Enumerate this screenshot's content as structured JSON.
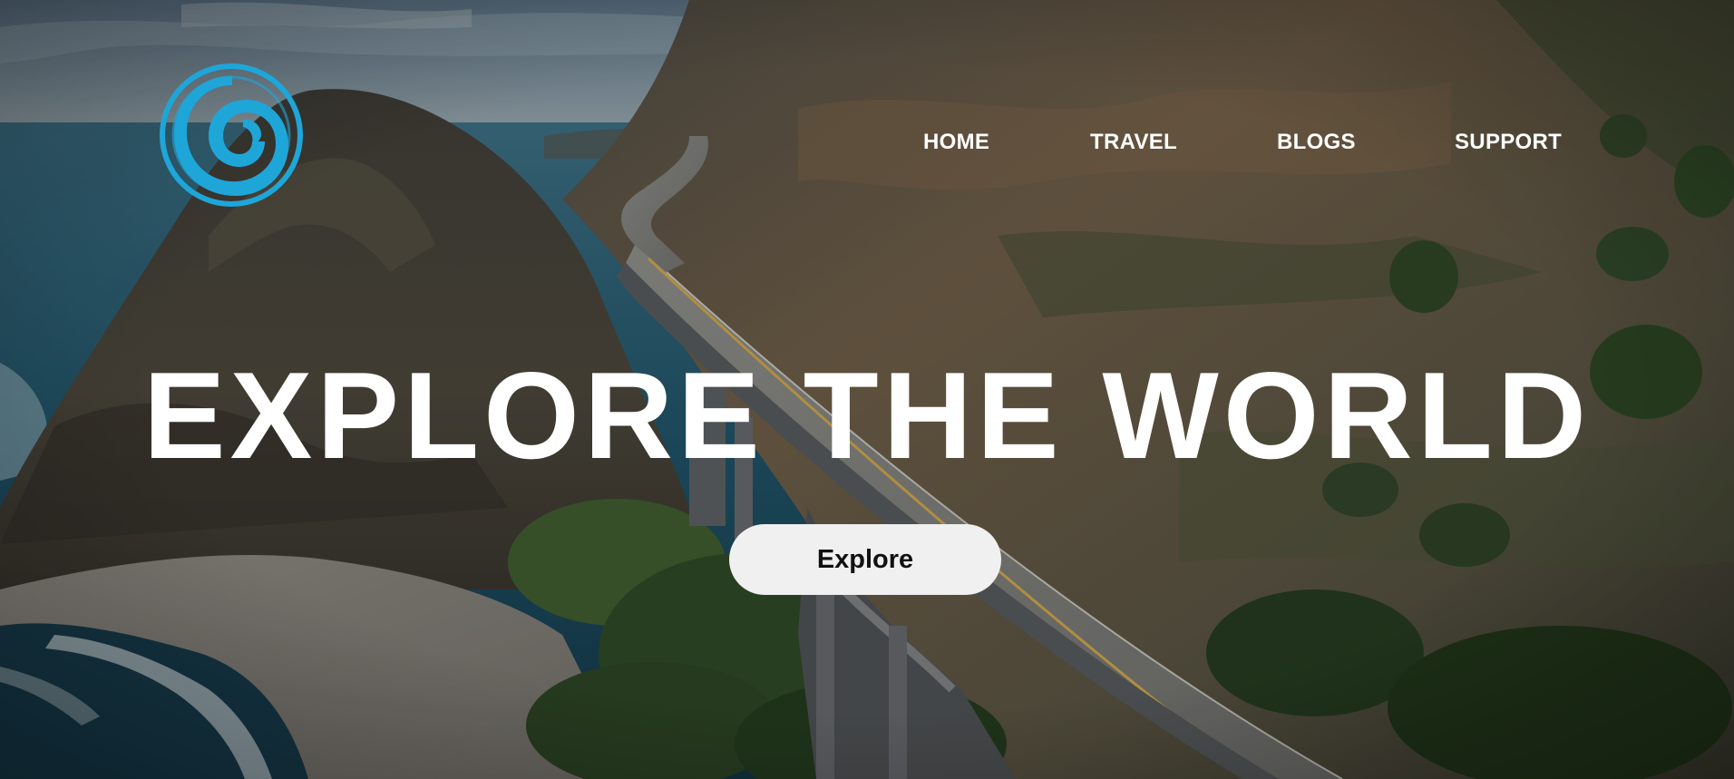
{
  "logo": {
    "icon": "swirl-logo-icon",
    "color": "#1ea6d9"
  },
  "nav": {
    "items": [
      {
        "label": "HOME"
      },
      {
        "label": "TRAVEL"
      },
      {
        "label": "BLOGS"
      },
      {
        "label": "SUPPORT"
      }
    ]
  },
  "hero": {
    "headline": "EXPLORE THE WORLD",
    "cta_label": "Explore",
    "background": "coastal-bridge-aerial-photo"
  },
  "colors": {
    "text": "#ffffff",
    "button_bg": "#f0f0f0",
    "button_text": "#111111",
    "accent": "#1ea6d9"
  }
}
